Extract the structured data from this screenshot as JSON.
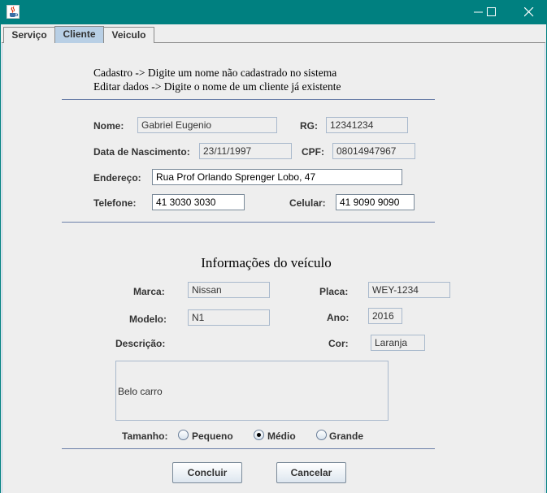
{
  "window": {
    "icon": "java-cup-icon",
    "controls": [
      "minimize-icon",
      "maximize-icon",
      "close-icon"
    ],
    "accent_color": "#008080"
  },
  "tabs": [
    {
      "label": "Serviço",
      "selected": false
    },
    {
      "label": "Cliente",
      "selected": true
    },
    {
      "label": "Veiculo",
      "selected": false
    }
  ],
  "info": {
    "line1": "Cadastro -> Digite um nome não cadastrado no sistema",
    "line2": "Editar dados -> Digite o nome de um cliente já existente"
  },
  "cliente": {
    "nome_label": "Nome:",
    "nome_value": "Gabriel Eugenio",
    "rg_label": "RG:",
    "rg_value": "12341234",
    "nascimento_label": "Data de Nascimento:",
    "nascimento_value": "23/11/1997",
    "cpf_label": "CPF:",
    "cpf_value": "08014947967",
    "endereco_label": "Endereço:",
    "endereco_value": "Rua Prof Orlando Sprenger Lobo, 47",
    "telefone_label": "Telefone:",
    "telefone_value": "41 3030 3030",
    "celular_label": "Celular:",
    "celular_value": "41 9090 9090"
  },
  "veiculo": {
    "title": "Informações do veículo",
    "marca_label": "Marca:",
    "marca_value": "Nissan",
    "placa_label": "Placa:",
    "placa_value": "WEY-1234",
    "modelo_label": "Modelo:",
    "modelo_value": "N1",
    "ano_label": "Ano:",
    "ano_value": "2016",
    "descricao_label": "Descrição:",
    "descricao_value": "Belo carro",
    "cor_label": "Cor:",
    "cor_value": "Laranja",
    "tamanho_label": "Tamanho:",
    "tamanho_options": [
      "Pequeno",
      "Médio",
      "Grande"
    ],
    "tamanho_selected": "Médio"
  },
  "buttons": {
    "concluir": "Concluir",
    "cancelar": "Cancelar"
  }
}
